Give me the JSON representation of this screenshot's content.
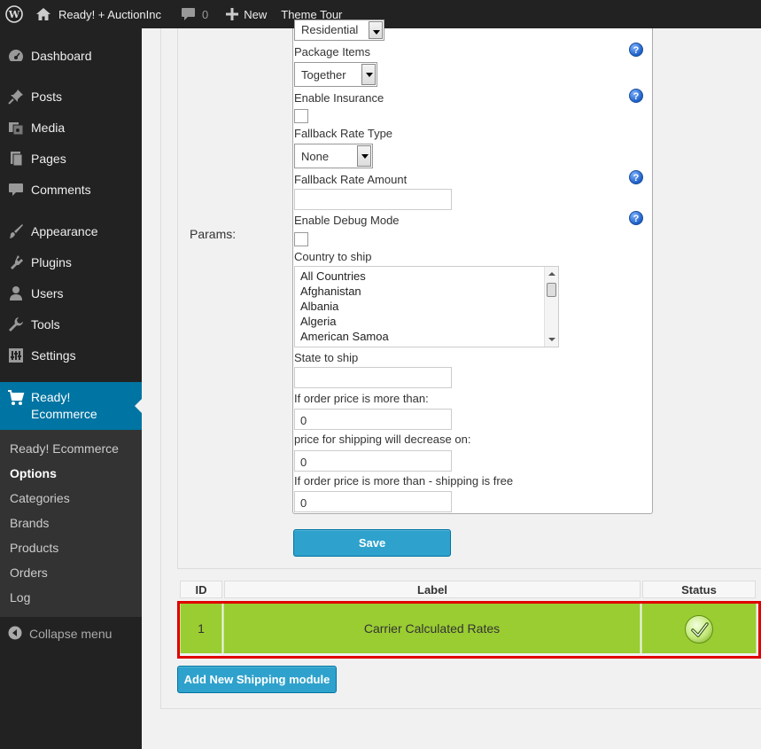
{
  "admin_bar": {
    "site_name": "Ready! + AuctionInc",
    "comment_count": "0",
    "new_label": "New",
    "theme_tour_label": "Theme Tour"
  },
  "sidebar": {
    "items": [
      {
        "label": "Dashboard",
        "icon": "dashboard-icon"
      },
      {
        "label": "Posts",
        "icon": "pin-icon"
      },
      {
        "label": "Media",
        "icon": "media-icon"
      },
      {
        "label": "Pages",
        "icon": "pages-icon"
      },
      {
        "label": "Comments",
        "icon": "comment-icon"
      },
      {
        "label": "Appearance",
        "icon": "brush-icon"
      },
      {
        "label": "Plugins",
        "icon": "plugin-icon"
      },
      {
        "label": "Users",
        "icon": "user-icon"
      },
      {
        "label": "Tools",
        "icon": "wrench-icon"
      },
      {
        "label": "Settings",
        "icon": "settings-icon"
      }
    ],
    "current": {
      "label_line1": "Ready!",
      "label_line2": "Ecommerce",
      "icon": "cart-icon"
    },
    "submenu": [
      {
        "label": "Ready! Ecommerce"
      },
      {
        "label": "Options"
      },
      {
        "label": "Categories"
      },
      {
        "label": "Brands"
      },
      {
        "label": "Products"
      },
      {
        "label": "Orders"
      },
      {
        "label": "Log"
      }
    ],
    "collapse_label": "Collapse menu"
  },
  "params": {
    "section_label": "Params:",
    "residential_value": "Residential",
    "package_items_label": "Package Items",
    "package_items_value": "Together",
    "enable_insurance_label": "Enable Insurance",
    "fallback_rate_type_label": "Fallback Rate Type",
    "fallback_rate_type_value": "None",
    "fallback_rate_amount_label": "Fallback Rate Amount",
    "fallback_rate_amount_value": "",
    "enable_debug_label": "Enable Debug Mode",
    "country_label": "Country to ship",
    "countries": [
      "All Countries",
      "Afghanistan",
      "Albania",
      "Algeria",
      "American Samoa"
    ],
    "state_label": "State to ship",
    "state_value": "",
    "order_price_more_label": "If order price is more than:",
    "order_price_more_value": "0",
    "price_decrease_label": "price for shipping will decrease on:",
    "price_decrease_value": "0",
    "free_shipping_label": "If order price is more than - shipping is free",
    "free_shipping_value": "0",
    "help_glyph": "?"
  },
  "save_label": "Save",
  "table": {
    "headers": [
      "ID",
      "Label",
      "Status"
    ],
    "row": {
      "id": "1",
      "label": "Carrier Calculated Rates",
      "status_icon": "check-icon"
    }
  },
  "add_button_label": "Add New Shipping module",
  "colors": {
    "row_highlight": "#9acd32",
    "selection_outline": "#e00000",
    "accent": "#0074a2",
    "button": "#2ea2cc"
  }
}
